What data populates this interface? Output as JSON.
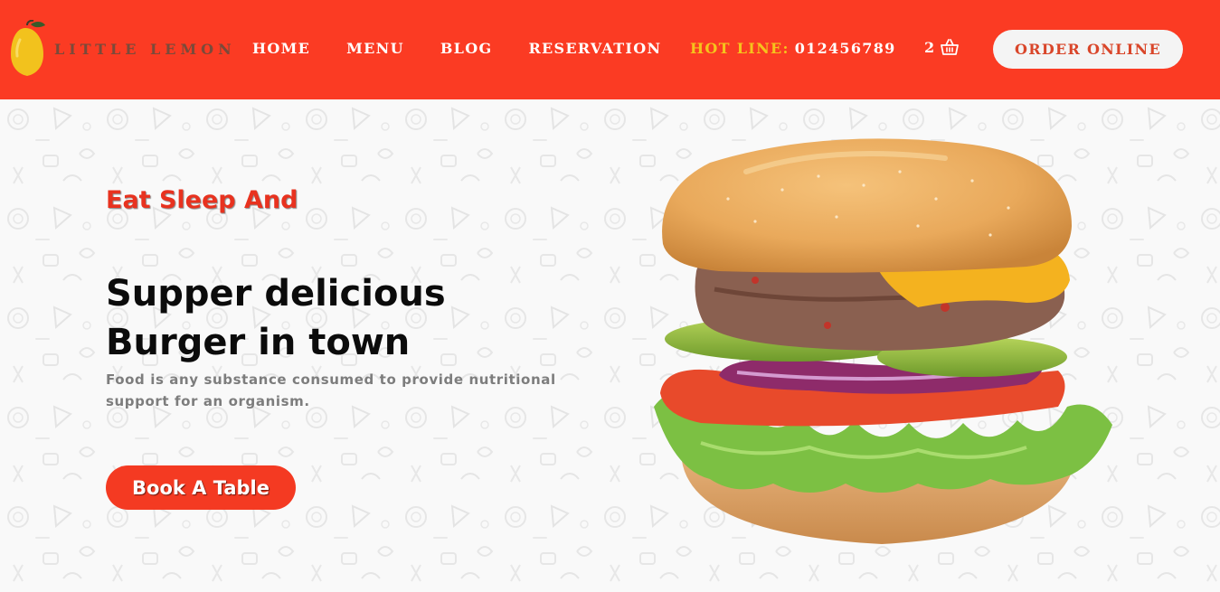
{
  "brand": {
    "name": "LITTLE LEMON",
    "logo_icon": "lemon-icon"
  },
  "nav": {
    "items": [
      {
        "label": "HOME"
      },
      {
        "label": "MENU"
      },
      {
        "label": "BLOG"
      },
      {
        "label": "RESERVATION"
      }
    ]
  },
  "hotline": {
    "label": "HOT LINE:",
    "number": "012456789"
  },
  "cart": {
    "count": "2",
    "icon": "shopping-basket-icon"
  },
  "order_button": {
    "label": "ORDER ONLINE"
  },
  "hero": {
    "tagline": "Eat Sleep And",
    "headline_line1": "Supper delicious",
    "headline_line2": "Burger in town",
    "description": "Food is any substance consumed to provide nutritional support for an organism.",
    "cta_label": "Book A Table",
    "image": "burger-image"
  },
  "colors": {
    "header_bg": "#fb3b23",
    "accent_red": "#f43a22",
    "hotline_yellow": "#f5c41c",
    "order_button_bg": "#f4f4f4",
    "order_button_text": "#d9462a",
    "headline_text": "#0b0b0b",
    "description_text": "#7d7d7d"
  }
}
